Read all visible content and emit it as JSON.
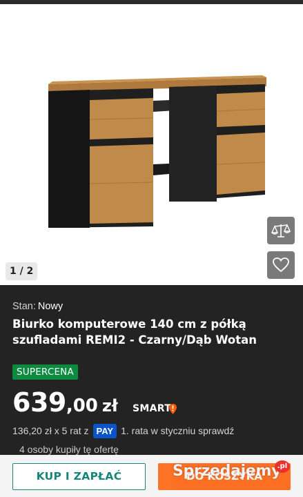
{
  "gallery": {
    "counter": "1 / 2",
    "compare_icon": "scales-icon",
    "favorite_icon": "heart-icon"
  },
  "product": {
    "condition_label": "Stan:",
    "condition_value": "Nowy",
    "title": "Biurko komputerowe 140 cm z półką szufladami REMI2 - Czarny/Dąb Wotan",
    "badge": "SUPERCENA",
    "price_main": "639",
    "price_frac": ",00",
    "currency": "zł",
    "smart_label": "SMART",
    "installments_text": "136,20 zł x 5 rat z",
    "pay_badge": "PAY",
    "installments_note": "1. rata w styczniu sprawdź",
    "buyers": "4 osoby kupiły tę ofertę"
  },
  "actions": {
    "buy_now": "KUP I ZAPŁAĆ",
    "add_to_cart": "DO KOSZYKA"
  },
  "watermark": {
    "text": "Sprzedajemy",
    "suffix": ".pl"
  },
  "colors": {
    "panel_bg": "#232323",
    "badge_green": "#0b8a40",
    "buy_teal": "#19857a",
    "cart_orange": "#ff5a00",
    "pay_blue": "#0b55c9"
  }
}
